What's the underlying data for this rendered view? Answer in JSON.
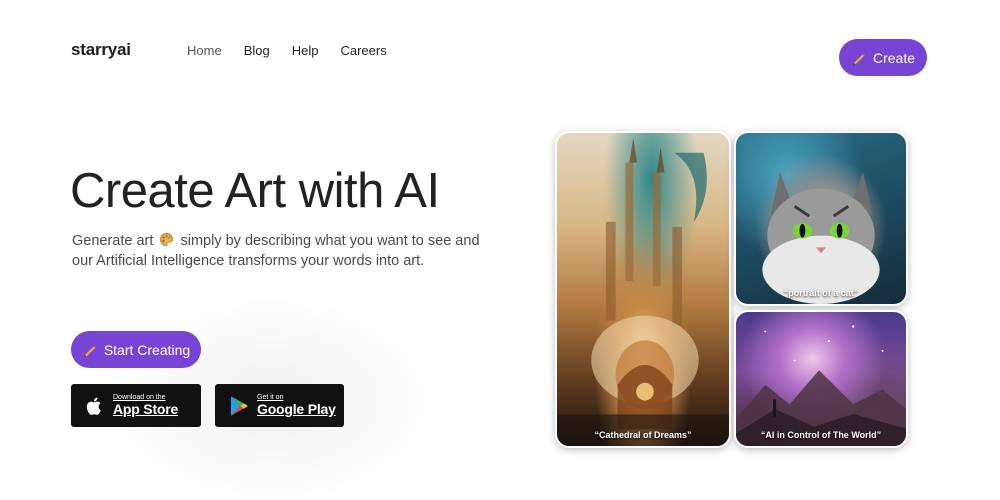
{
  "brand": {
    "logo": "starryai"
  },
  "nav": {
    "items": [
      "Home",
      "Blog",
      "Help",
      "Careers"
    ]
  },
  "header": {
    "create_label": "Create"
  },
  "hero": {
    "headline": "Create Art with AI",
    "sub_before": "Generate art",
    "sub_after": "simply by describing what you want to see and our Artificial Intelligence transforms your words into art.",
    "start_label": "Start Creating"
  },
  "stores": {
    "apple_small": "Download on the",
    "apple_big": "App Store",
    "google_small": "Get it on",
    "google_big": "Google Play"
  },
  "gallery": {
    "cathedral_caption": "“Cathedral of Dreams”",
    "cat_caption": "“portrait of a cat”",
    "space_caption": "“AI in Control of The World”"
  },
  "colors": {
    "accent": "#7744d6",
    "store_bg": "#111111"
  },
  "icons": [
    "pencil-icon",
    "palette-icon",
    "apple-icon",
    "google-play-icon"
  ]
}
